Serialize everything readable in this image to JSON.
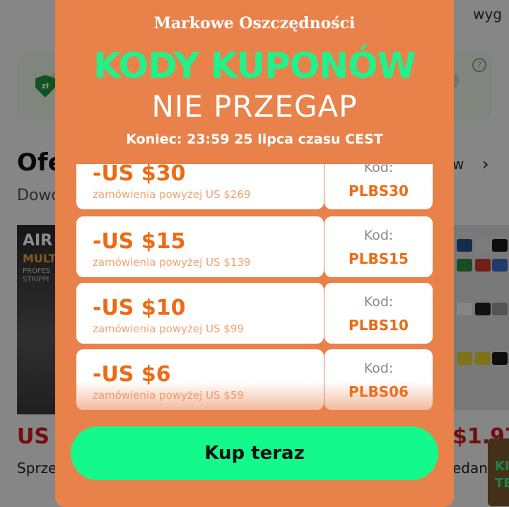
{
  "background": {
    "top_right_text": "wyg",
    "section_title": "Ofe",
    "section_subtitle": "Dowo",
    "see_more": "w",
    "left_product": {
      "image_text_line1": "AIR",
      "image_text_line2": "MULT",
      "image_text_line3": "PROFES STRIPPI",
      "price": "US $",
      "name": "Sprze"
    },
    "right_product": {
      "price": "$1.97",
      "name": "edan"
    },
    "side_tab": "KI TE",
    "shield_text": "zł",
    "help_text": "?"
  },
  "modal": {
    "brand": "Markowe Oszczędności",
    "headline": "KODY KUPONÓW",
    "subheadline": "NIE PRZEGAP",
    "deadline": "Koniec: 23:59 25 lipca czasu CEST",
    "coupons": [
      {
        "amount": "-US $30",
        "condition": "zamówienia powyżej US $269",
        "code_label": "Kod:",
        "code": "PLBS30"
      },
      {
        "amount": "-US $15",
        "condition": "zamówienia powyżej US $139",
        "code_label": "Kod:",
        "code": "PLBS15"
      },
      {
        "amount": "-US $10",
        "condition": "zamówienia powyżej US $99",
        "code_label": "Kod:",
        "code": "PLBS10"
      },
      {
        "amount": "-US $6",
        "condition": "zamówienia powyżej US $59",
        "code_label": "Kod:",
        "code": "PLBS06"
      }
    ],
    "buy_button": "Kup teraz"
  },
  "colors": {
    "modal_bg": "#e8824a",
    "headline_green": "#22f08c",
    "button_green": "#14f98c",
    "coupon_accent": "#ee6a14",
    "price_red": "#d01a1a"
  }
}
